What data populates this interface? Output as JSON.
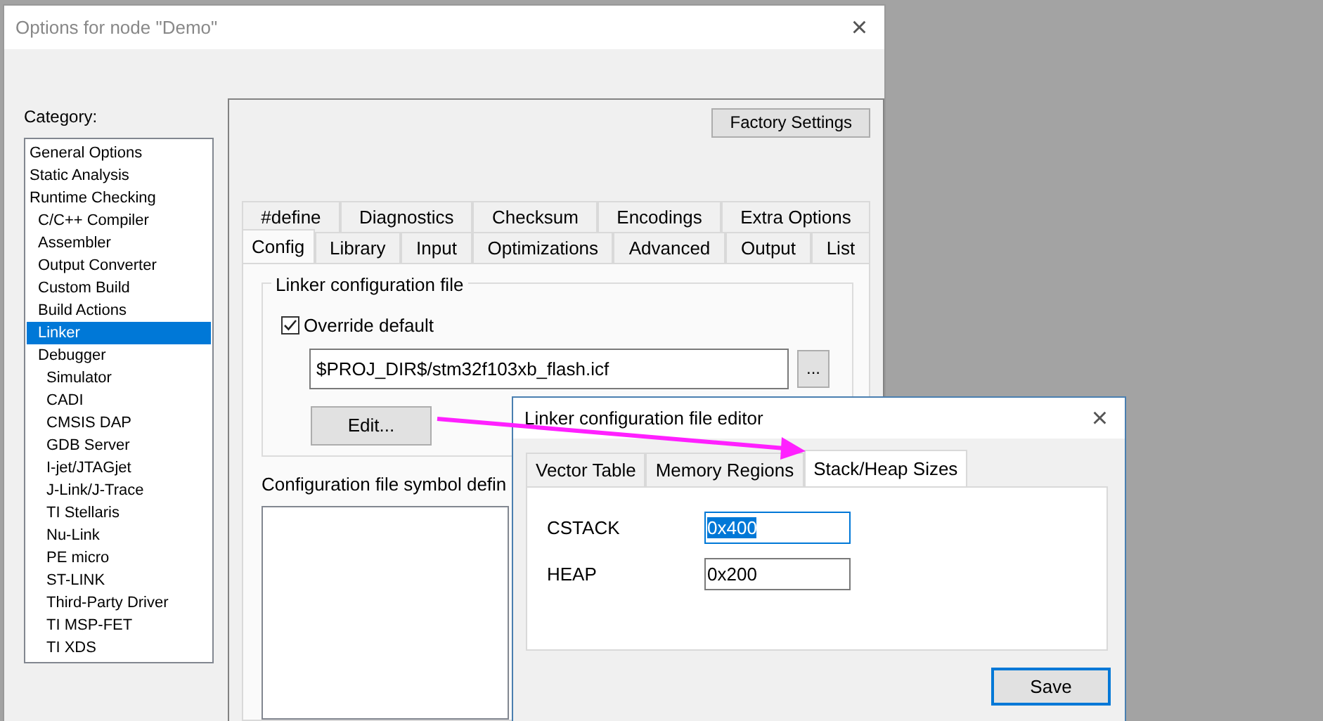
{
  "options_window": {
    "title": "Options for node \"Demo\"",
    "close": "×",
    "category_label": "Category:",
    "categories": [
      {
        "label": "General Options",
        "selected": false
      },
      {
        "label": "Static Analysis",
        "selected": false
      },
      {
        "label": "Runtime Checking",
        "selected": false,
        "children": [
          {
            "label": "C/C++ Compiler",
            "selected": false
          },
          {
            "label": "Assembler",
            "selected": false
          },
          {
            "label": "Output Converter",
            "selected": false
          },
          {
            "label": "Custom Build",
            "selected": false
          },
          {
            "label": "Build Actions",
            "selected": false
          },
          {
            "label": "Linker",
            "selected": true
          },
          {
            "label": "Debugger",
            "selected": false,
            "children": [
              {
                "label": "Simulator",
                "selected": false
              },
              {
                "label": "CADI",
                "selected": false
              },
              {
                "label": "CMSIS DAP",
                "selected": false
              },
              {
                "label": "GDB Server",
                "selected": false
              },
              {
                "label": "I-jet/JTAGjet",
                "selected": false
              },
              {
                "label": "J-Link/J-Trace",
                "selected": false
              },
              {
                "label": "TI Stellaris",
                "selected": false
              },
              {
                "label": "Nu-Link",
                "selected": false
              },
              {
                "label": "PE micro",
                "selected": false
              },
              {
                "label": "ST-LINK",
                "selected": false
              },
              {
                "label": "Third-Party Driver",
                "selected": false
              },
              {
                "label": "TI MSP-FET",
                "selected": false
              },
              {
                "label": "TI XDS",
                "selected": false
              }
            ]
          }
        ]
      }
    ],
    "factory_button": "Factory Settings",
    "tab_rows": [
      {
        "tabs": [
          {
            "label": "#define",
            "selected": false
          },
          {
            "label": "Diagnostics",
            "selected": false
          },
          {
            "label": "Checksum",
            "selected": false
          },
          {
            "label": "Encodings",
            "selected": false
          },
          {
            "label": "Extra Options",
            "selected": false
          }
        ]
      },
      {
        "tabs": [
          {
            "label": "Config",
            "selected": true
          },
          {
            "label": "Library",
            "selected": false
          },
          {
            "label": "Input",
            "selected": false
          },
          {
            "label": "Optimizations",
            "selected": false
          },
          {
            "label": "Advanced",
            "selected": false
          },
          {
            "label": "Output",
            "selected": false
          },
          {
            "label": "List",
            "selected": false
          }
        ]
      }
    ],
    "config_group": {
      "title": "Linker configuration file",
      "override": {
        "label": "Override default",
        "checked": true
      },
      "file_path": "$PROJ_DIR$/stm32f103xb_flash.icf",
      "browse_button": "...",
      "edit_button": "Edit..."
    },
    "symbol_label": "Configuration file symbol defin"
  },
  "editor_window": {
    "title": "Linker configuration file editor",
    "tabs": [
      {
        "label": "Vector Table",
        "selected": false
      },
      {
        "label": "Memory Regions",
        "selected": false
      },
      {
        "label": "Stack/Heap Sizes",
        "selected": true
      }
    ],
    "fields": [
      {
        "label": "CSTACK",
        "value": "0x400",
        "text_selected": true
      },
      {
        "label": "HEAP",
        "value": "0x200",
        "text_selected": false
      }
    ],
    "save_button": "Save"
  }
}
